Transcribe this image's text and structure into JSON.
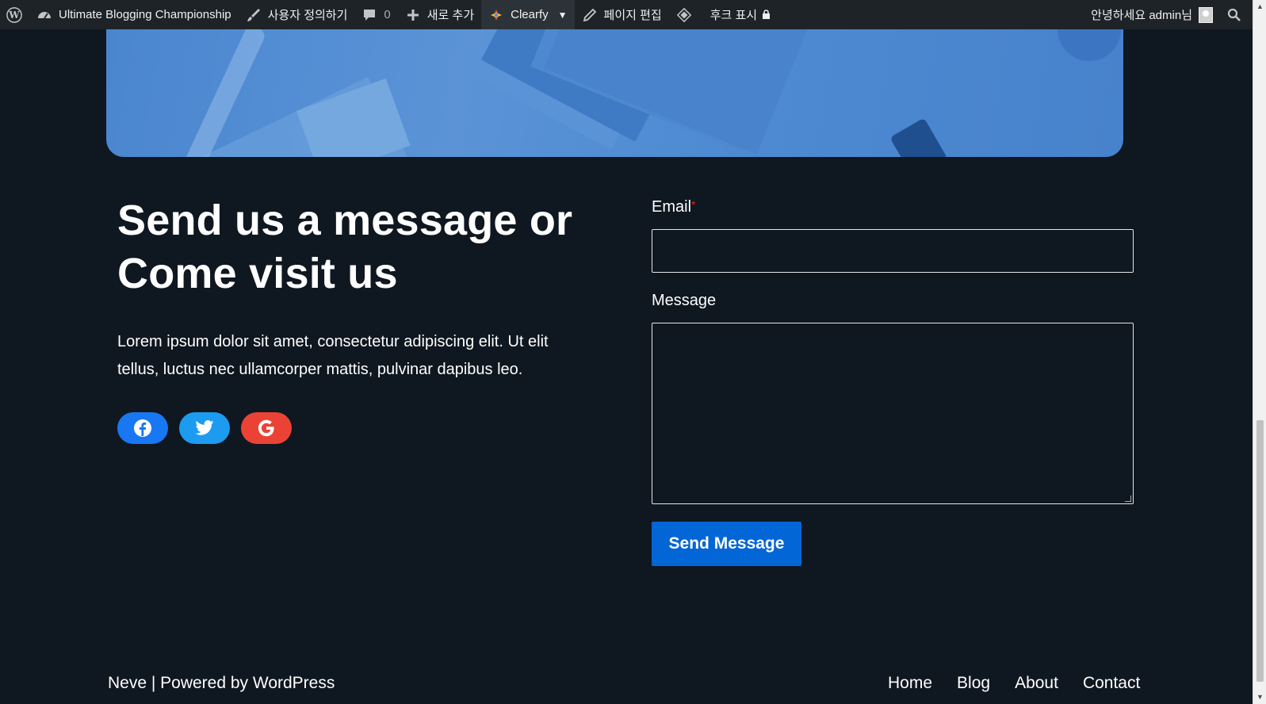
{
  "adminbar": {
    "site_name": "Ultimate Blogging Championship",
    "customize": "사용자 정의하기",
    "comments_count": "0",
    "new": "새로 추가",
    "clearfy": "Clearfy",
    "edit_page": "페이지 편집",
    "show_hooks": "후크 표시",
    "greeting": "안녕하세요 admin님"
  },
  "contact": {
    "headline": "Send us a message or Come visit us",
    "intro": "Lorem ipsum dolor sit amet, consectetur adipiscing elit. Ut elit tellus, luctus nec ullamcorper mattis, pulvinar dapibus leo.",
    "socials": [
      {
        "name": "facebook",
        "color": "#1877f2"
      },
      {
        "name": "twitter",
        "color": "#1d9bf0"
      },
      {
        "name": "google",
        "color": "#ea4335"
      }
    ]
  },
  "form": {
    "email_label": "Email",
    "required_mark": "*",
    "email_value": "",
    "message_label": "Message",
    "message_value": "",
    "submit_label": "Send Message"
  },
  "footer": {
    "credit": "Neve | Powered by WordPress",
    "nav": [
      "Home",
      "Blog",
      "About",
      "Contact"
    ]
  },
  "colors": {
    "background": "#0f1720",
    "accent": "#0366d6",
    "adminbar": "#1d2327"
  }
}
